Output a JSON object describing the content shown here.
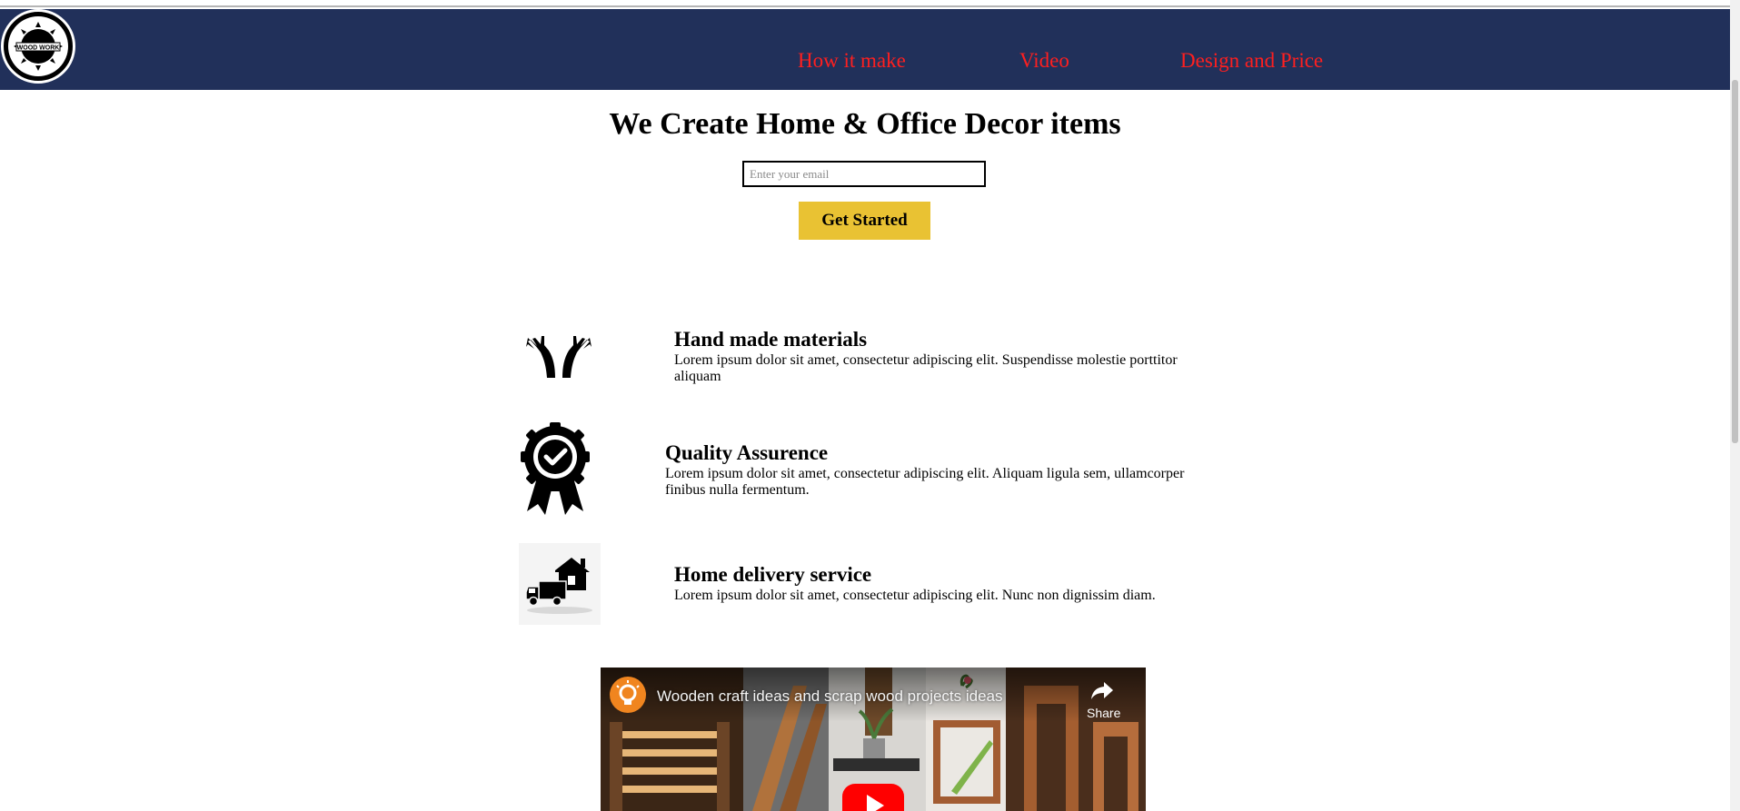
{
  "header": {
    "logo_text": "WOOD WORK",
    "nav": [
      {
        "label": "How it make"
      },
      {
        "label": "Video"
      },
      {
        "label": "Design and Price"
      }
    ]
  },
  "hero": {
    "title": "We Create Home & Office Decor items",
    "email_placeholder": "Enter your email",
    "cta_label": "Get Started"
  },
  "features": [
    {
      "icon": "hands-icon",
      "title": "Hand made materials",
      "text": "Lorem ipsum dolor sit amet, consectetur adipiscing elit. Suspendisse molestie porttitor aliquam"
    },
    {
      "icon": "quality-badge-icon",
      "title": "Quality Assurence",
      "text": "Lorem ipsum dolor sit amet, consectetur adipiscing elit. Aliquam ligula sem, ullamcorper finibus nulla fermentum."
    },
    {
      "icon": "delivery-truck-house-icon",
      "title": "Home delivery service",
      "text": "Lorem ipsum dolor sit amet, consectetur adipiscing elit. Nunc non dignissim diam."
    }
  ],
  "video": {
    "title": "Wooden craft ideas and scrap wood projects ideas",
    "share_label": "Share"
  },
  "colors": {
    "navbar": "#21305a",
    "nav_link": "#ff1f1f",
    "cta": "#e9c233",
    "youtube_red": "#ff0000"
  }
}
